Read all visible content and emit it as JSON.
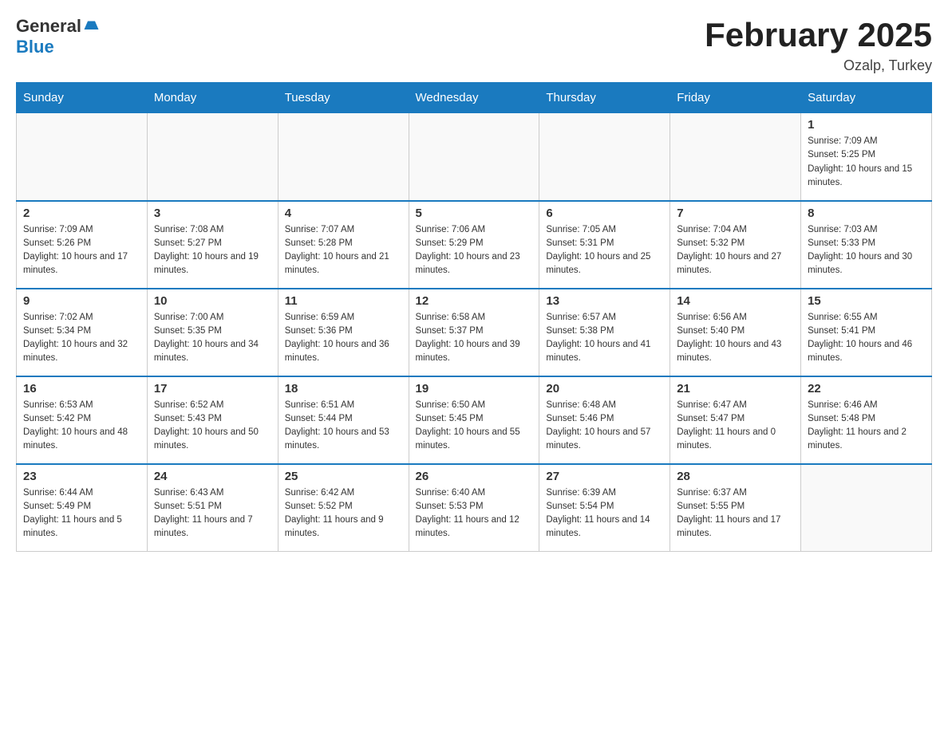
{
  "header": {
    "logo_general": "General",
    "logo_arrow": "▲",
    "logo_blue": "Blue",
    "month_title": "February 2025",
    "location": "Ozalp, Turkey"
  },
  "weekdays": [
    "Sunday",
    "Monday",
    "Tuesday",
    "Wednesday",
    "Thursday",
    "Friday",
    "Saturday"
  ],
  "weeks": [
    [
      {
        "day": "",
        "sunrise": "",
        "sunset": "",
        "daylight": ""
      },
      {
        "day": "",
        "sunrise": "",
        "sunset": "",
        "daylight": ""
      },
      {
        "day": "",
        "sunrise": "",
        "sunset": "",
        "daylight": ""
      },
      {
        "day": "",
        "sunrise": "",
        "sunset": "",
        "daylight": ""
      },
      {
        "day": "",
        "sunrise": "",
        "sunset": "",
        "daylight": ""
      },
      {
        "day": "",
        "sunrise": "",
        "sunset": "",
        "daylight": ""
      },
      {
        "day": "1",
        "sunrise": "Sunrise: 7:09 AM",
        "sunset": "Sunset: 5:25 PM",
        "daylight": "Daylight: 10 hours and 15 minutes."
      }
    ],
    [
      {
        "day": "2",
        "sunrise": "Sunrise: 7:09 AM",
        "sunset": "Sunset: 5:26 PM",
        "daylight": "Daylight: 10 hours and 17 minutes."
      },
      {
        "day": "3",
        "sunrise": "Sunrise: 7:08 AM",
        "sunset": "Sunset: 5:27 PM",
        "daylight": "Daylight: 10 hours and 19 minutes."
      },
      {
        "day": "4",
        "sunrise": "Sunrise: 7:07 AM",
        "sunset": "Sunset: 5:28 PM",
        "daylight": "Daylight: 10 hours and 21 minutes."
      },
      {
        "day": "5",
        "sunrise": "Sunrise: 7:06 AM",
        "sunset": "Sunset: 5:29 PM",
        "daylight": "Daylight: 10 hours and 23 minutes."
      },
      {
        "day": "6",
        "sunrise": "Sunrise: 7:05 AM",
        "sunset": "Sunset: 5:31 PM",
        "daylight": "Daylight: 10 hours and 25 minutes."
      },
      {
        "day": "7",
        "sunrise": "Sunrise: 7:04 AM",
        "sunset": "Sunset: 5:32 PM",
        "daylight": "Daylight: 10 hours and 27 minutes."
      },
      {
        "day": "8",
        "sunrise": "Sunrise: 7:03 AM",
        "sunset": "Sunset: 5:33 PM",
        "daylight": "Daylight: 10 hours and 30 minutes."
      }
    ],
    [
      {
        "day": "9",
        "sunrise": "Sunrise: 7:02 AM",
        "sunset": "Sunset: 5:34 PM",
        "daylight": "Daylight: 10 hours and 32 minutes."
      },
      {
        "day": "10",
        "sunrise": "Sunrise: 7:00 AM",
        "sunset": "Sunset: 5:35 PM",
        "daylight": "Daylight: 10 hours and 34 minutes."
      },
      {
        "day": "11",
        "sunrise": "Sunrise: 6:59 AM",
        "sunset": "Sunset: 5:36 PM",
        "daylight": "Daylight: 10 hours and 36 minutes."
      },
      {
        "day": "12",
        "sunrise": "Sunrise: 6:58 AM",
        "sunset": "Sunset: 5:37 PM",
        "daylight": "Daylight: 10 hours and 39 minutes."
      },
      {
        "day": "13",
        "sunrise": "Sunrise: 6:57 AM",
        "sunset": "Sunset: 5:38 PM",
        "daylight": "Daylight: 10 hours and 41 minutes."
      },
      {
        "day": "14",
        "sunrise": "Sunrise: 6:56 AM",
        "sunset": "Sunset: 5:40 PM",
        "daylight": "Daylight: 10 hours and 43 minutes."
      },
      {
        "day": "15",
        "sunrise": "Sunrise: 6:55 AM",
        "sunset": "Sunset: 5:41 PM",
        "daylight": "Daylight: 10 hours and 46 minutes."
      }
    ],
    [
      {
        "day": "16",
        "sunrise": "Sunrise: 6:53 AM",
        "sunset": "Sunset: 5:42 PM",
        "daylight": "Daylight: 10 hours and 48 minutes."
      },
      {
        "day": "17",
        "sunrise": "Sunrise: 6:52 AM",
        "sunset": "Sunset: 5:43 PM",
        "daylight": "Daylight: 10 hours and 50 minutes."
      },
      {
        "day": "18",
        "sunrise": "Sunrise: 6:51 AM",
        "sunset": "Sunset: 5:44 PM",
        "daylight": "Daylight: 10 hours and 53 minutes."
      },
      {
        "day": "19",
        "sunrise": "Sunrise: 6:50 AM",
        "sunset": "Sunset: 5:45 PM",
        "daylight": "Daylight: 10 hours and 55 minutes."
      },
      {
        "day": "20",
        "sunrise": "Sunrise: 6:48 AM",
        "sunset": "Sunset: 5:46 PM",
        "daylight": "Daylight: 10 hours and 57 minutes."
      },
      {
        "day": "21",
        "sunrise": "Sunrise: 6:47 AM",
        "sunset": "Sunset: 5:47 PM",
        "daylight": "Daylight: 11 hours and 0 minutes."
      },
      {
        "day": "22",
        "sunrise": "Sunrise: 6:46 AM",
        "sunset": "Sunset: 5:48 PM",
        "daylight": "Daylight: 11 hours and 2 minutes."
      }
    ],
    [
      {
        "day": "23",
        "sunrise": "Sunrise: 6:44 AM",
        "sunset": "Sunset: 5:49 PM",
        "daylight": "Daylight: 11 hours and 5 minutes."
      },
      {
        "day": "24",
        "sunrise": "Sunrise: 6:43 AM",
        "sunset": "Sunset: 5:51 PM",
        "daylight": "Daylight: 11 hours and 7 minutes."
      },
      {
        "day": "25",
        "sunrise": "Sunrise: 6:42 AM",
        "sunset": "Sunset: 5:52 PM",
        "daylight": "Daylight: 11 hours and 9 minutes."
      },
      {
        "day": "26",
        "sunrise": "Sunrise: 6:40 AM",
        "sunset": "Sunset: 5:53 PM",
        "daylight": "Daylight: 11 hours and 12 minutes."
      },
      {
        "day": "27",
        "sunrise": "Sunrise: 6:39 AM",
        "sunset": "Sunset: 5:54 PM",
        "daylight": "Daylight: 11 hours and 14 minutes."
      },
      {
        "day": "28",
        "sunrise": "Sunrise: 6:37 AM",
        "sunset": "Sunset: 5:55 PM",
        "daylight": "Daylight: 11 hours and 17 minutes."
      },
      {
        "day": "",
        "sunrise": "",
        "sunset": "",
        "daylight": ""
      }
    ]
  ]
}
